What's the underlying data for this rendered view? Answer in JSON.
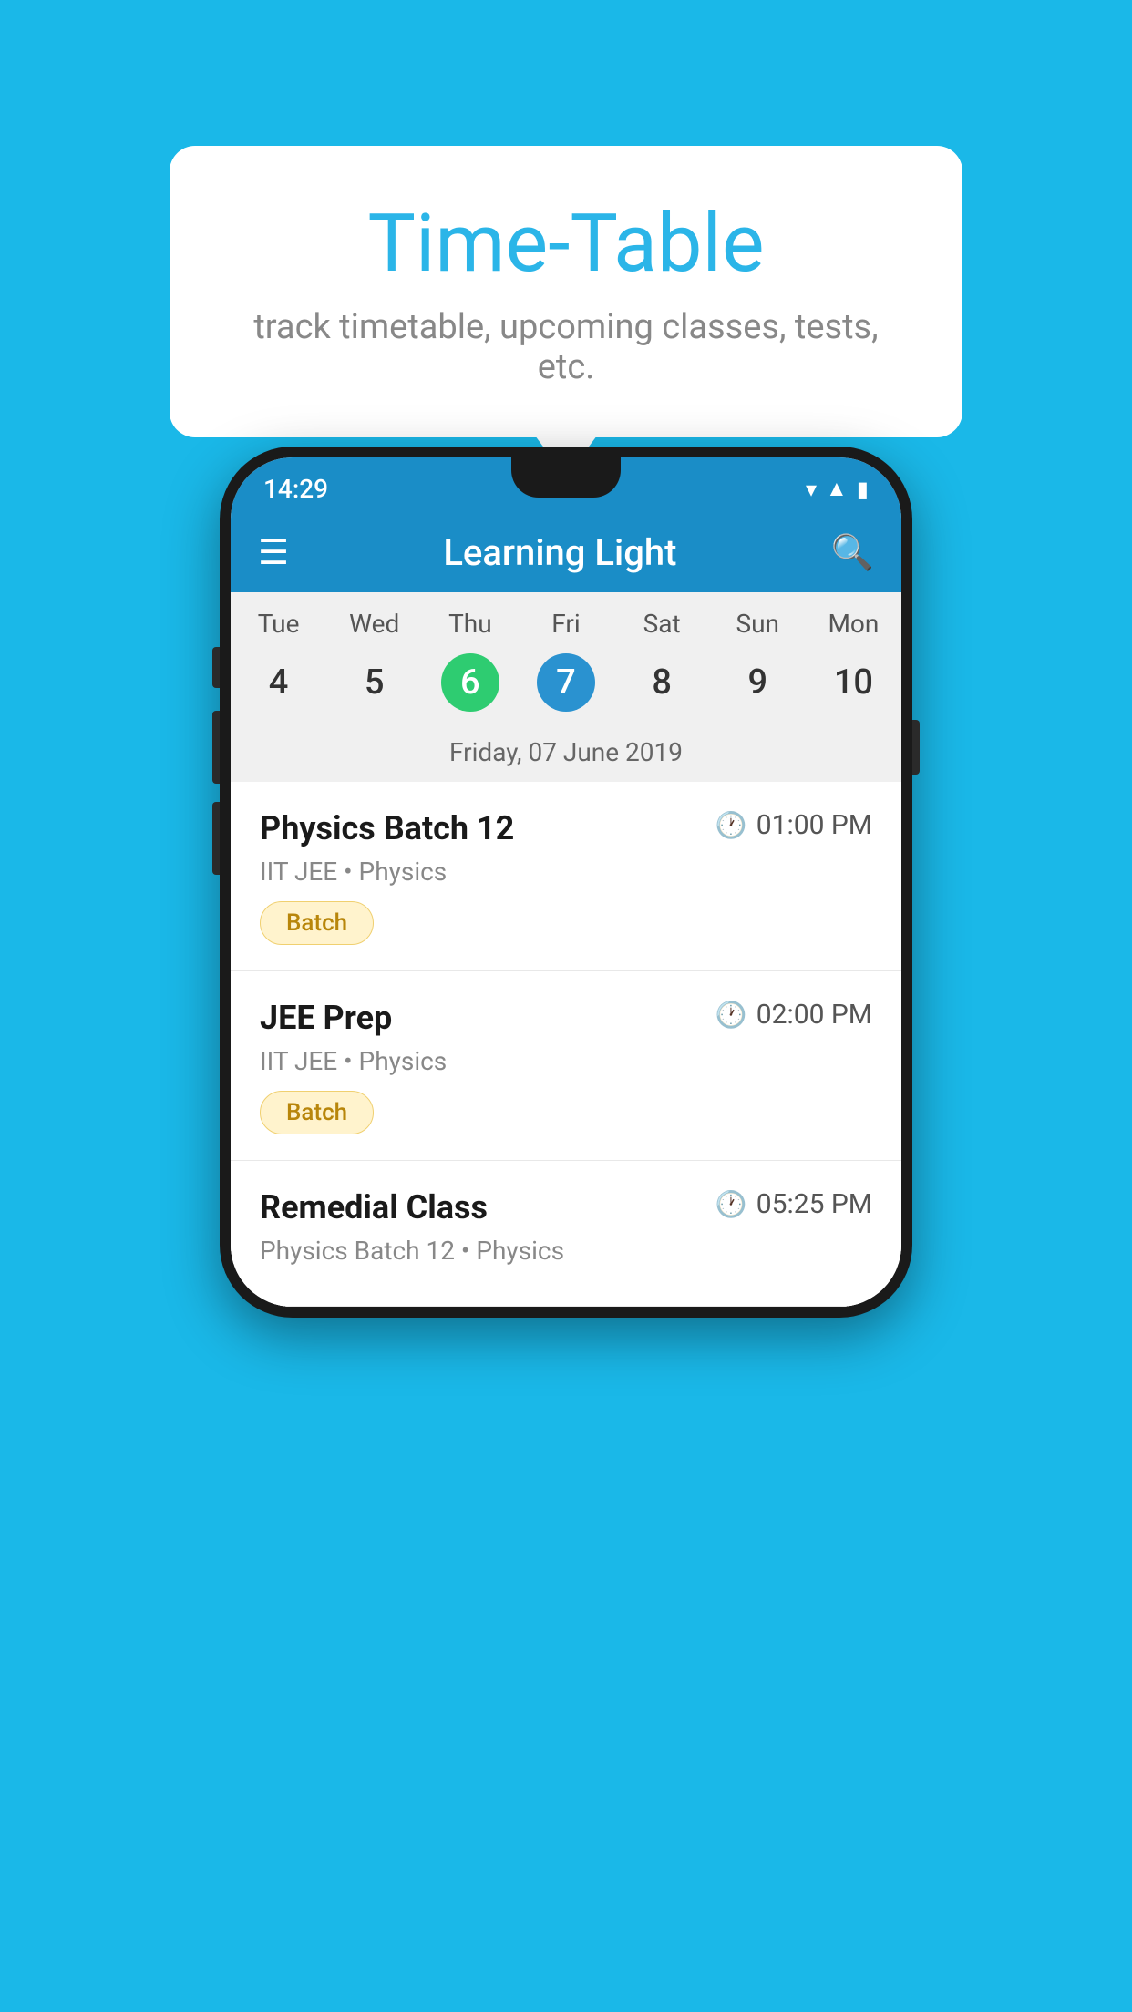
{
  "background_color": "#1ab8e8",
  "tooltip": {
    "title": "Time-Table",
    "subtitle": "track timetable, upcoming classes, tests, etc."
  },
  "phone": {
    "status_bar": {
      "time": "14:29"
    },
    "app_bar": {
      "title": "Learning Light"
    },
    "calendar": {
      "days": [
        {
          "label": "Tue",
          "number": "4"
        },
        {
          "label": "Wed",
          "number": "5"
        },
        {
          "label": "Thu",
          "number": "6",
          "state": "today"
        },
        {
          "label": "Fri",
          "number": "7",
          "state": "selected"
        },
        {
          "label": "Sat",
          "number": "8"
        },
        {
          "label": "Sun",
          "number": "9"
        },
        {
          "label": "Mon",
          "number": "10"
        }
      ],
      "selected_date_label": "Friday, 07 June 2019"
    },
    "schedule": [
      {
        "title": "Physics Batch 12",
        "time": "01:00 PM",
        "meta": "IIT JEE • Physics",
        "badge": "Batch"
      },
      {
        "title": "JEE Prep",
        "time": "02:00 PM",
        "meta": "IIT JEE • Physics",
        "badge": "Batch"
      },
      {
        "title": "Remedial Class",
        "time": "05:25 PM",
        "meta": "Physics Batch 12 • Physics",
        "badge": null
      }
    ]
  }
}
